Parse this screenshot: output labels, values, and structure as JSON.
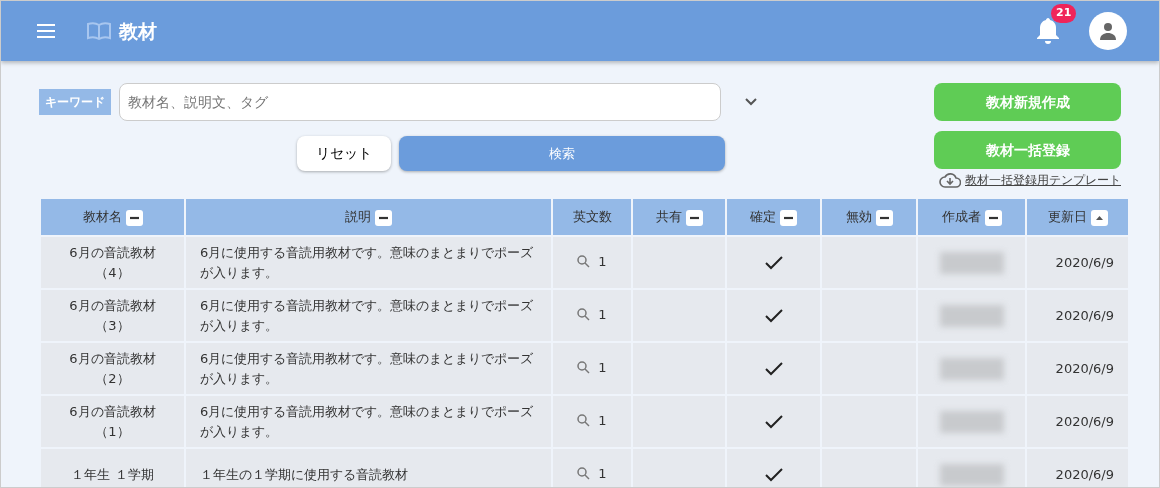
{
  "header": {
    "title": "教材",
    "notification_count": "21"
  },
  "search": {
    "label": "キーワード",
    "placeholder": "教材名、説明文、タグ",
    "reset_button": "リセット",
    "search_button": "検索"
  },
  "actions": {
    "buttons": [
      "教材新規作成",
      "教材一括登録"
    ],
    "template_link": "教材一括登録用テンプレート"
  },
  "table": {
    "columns": [
      {
        "label": "教材名",
        "kind": "collapsible"
      },
      {
        "label": "説明",
        "kind": "collapsible"
      },
      {
        "label": "英文数",
        "kind": "plain"
      },
      {
        "label": "共有",
        "kind": "collapsible"
      },
      {
        "label": "確定",
        "kind": "collapsible"
      },
      {
        "label": "無効",
        "kind": "collapsible"
      },
      {
        "label": "作成者",
        "kind": "collapsible"
      },
      {
        "label": "更新日",
        "kind": "sorted"
      }
    ],
    "rows": [
      {
        "name": "6月の音読教材（4）",
        "description": "6月に使用する音読用教材です。意味のまとまりでポーズが入ります。",
        "sentences": "1",
        "shared": false,
        "confirmed": true,
        "disabled": false,
        "updated": "2020/6/9"
      },
      {
        "name": "6月の音読教材（3）",
        "description": "6月に使用する音読用教材です。意味のまとまりでポーズが入ります。",
        "sentences": "1",
        "shared": false,
        "confirmed": true,
        "disabled": false,
        "updated": "2020/6/9"
      },
      {
        "name": "6月の音読教材（2）",
        "description": "6月に使用する音読用教材です。意味のまとまりでポーズが入ります。",
        "sentences": "1",
        "shared": false,
        "confirmed": true,
        "disabled": false,
        "updated": "2020/6/9"
      },
      {
        "name": "6月の音読教材（1）",
        "description": "6月に使用する音読用教材です。意味のまとまりでポーズが入ります。",
        "sentences": "1",
        "shared": false,
        "confirmed": true,
        "disabled": false,
        "updated": "2020/6/9"
      },
      {
        "name": "１年生 １学期",
        "description": "１年生の１学期に使用する音読教材",
        "sentences": "1",
        "shared": false,
        "confirmed": true,
        "disabled": false,
        "updated": "2020/6/9"
      }
    ]
  }
}
